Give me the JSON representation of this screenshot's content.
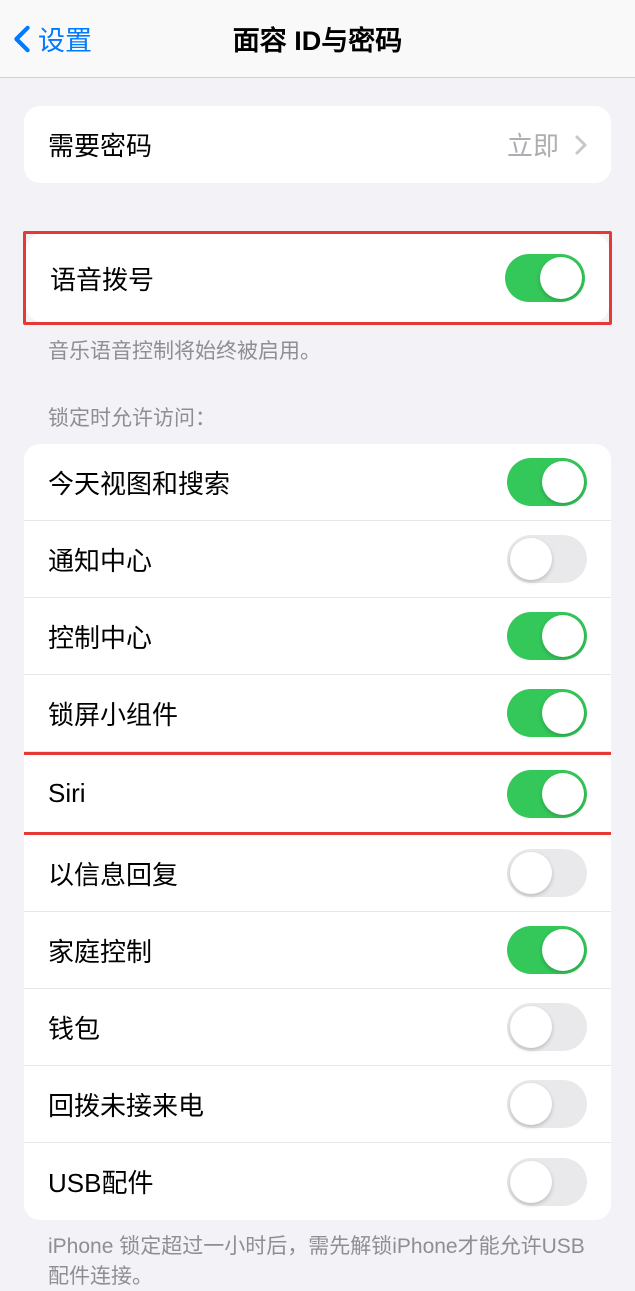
{
  "header": {
    "back_label": "设置",
    "title": "面容 ID与密码"
  },
  "passcode": {
    "label": "需要密码",
    "value": "立即"
  },
  "voice_dial": {
    "label": "语音拨号",
    "on": true,
    "footer": "音乐语音控制将始终被启用。"
  },
  "allow_section": {
    "header": "锁定时允许访问：",
    "items": [
      {
        "label": "今天视图和搜索",
        "on": true
      },
      {
        "label": "通知中心",
        "on": false
      },
      {
        "label": "控制中心",
        "on": true
      },
      {
        "label": "锁屏小组件",
        "on": true
      },
      {
        "label": "Siri",
        "on": true
      },
      {
        "label": "以信息回复",
        "on": false
      },
      {
        "label": "家庭控制",
        "on": true
      },
      {
        "label": "钱包",
        "on": false
      },
      {
        "label": "回拨未接来电",
        "on": false
      },
      {
        "label": "USB配件",
        "on": false
      }
    ],
    "footer": "iPhone 锁定超过一小时后，需先解锁iPhone才能允许USB 配件连接。"
  }
}
